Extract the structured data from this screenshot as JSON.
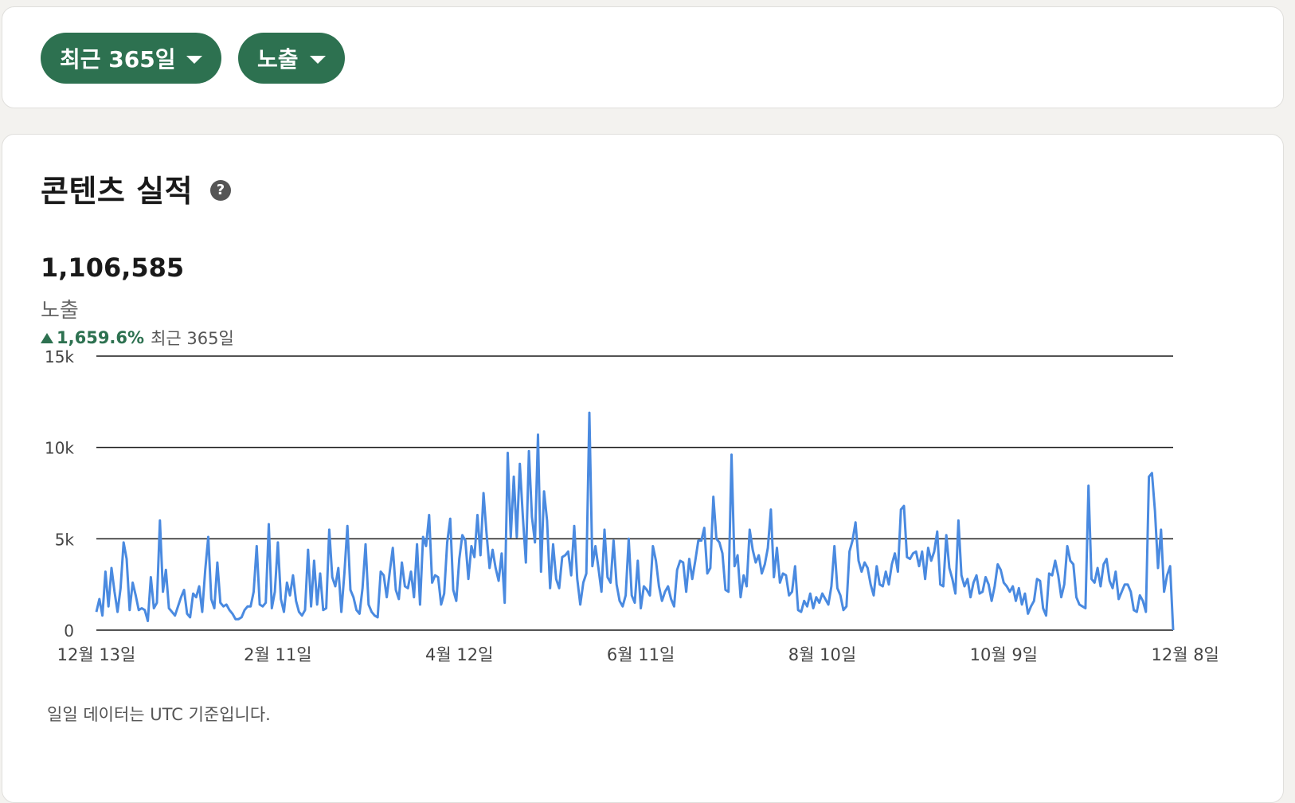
{
  "filters": {
    "range_label": "최근 365일",
    "metric_label": "노출"
  },
  "performance": {
    "title": "콘텐츠 실적",
    "help_icon": "question-circle-icon",
    "total_value": "1,106,585",
    "metric": "노출",
    "change_percent": "1,659.6%",
    "change_period": "최근 365일",
    "footnote": "일일 데이터는 UTC 기준입니다."
  },
  "colors": {
    "accent": "#2d7150",
    "line": "#4a8ae0",
    "grid": "#1a1a1a"
  },
  "chart_data": {
    "type": "line",
    "y_ticks": [
      "0",
      "5k",
      "10k",
      "15k"
    ],
    "ylim": [
      0,
      15000
    ],
    "x_tick_labels": [
      "12월 13일",
      "2월 11일",
      "4월 12일",
      "6월 11일",
      "8월 10일",
      "10월 9일",
      "12월 8일"
    ],
    "x_tick_days": [
      0,
      60,
      120,
      180,
      240,
      300,
      360
    ],
    "series": [
      {
        "values": [
          1000,
          1700,
          800,
          3200,
          1300,
          3400,
          2100,
          1000,
          2300,
          4800,
          3900,
          1100,
          2600,
          1900,
          1100,
          1200,
          1100,
          500,
          2900,
          1200,
          1500,
          6000,
          2100,
          3300,
          1200,
          1000,
          800,
          1300,
          1800,
          2200,
          900,
          700,
          2000,
          1800,
          2400,
          1000,
          3300,
          5100,
          1700,
          1200,
          3700,
          1500,
          1300,
          1400,
          1100,
          900,
          600,
          600,
          700,
          1100,
          1300,
          1300,
          2100,
          4600,
          1400,
          1300,
          1500,
          5800,
          1200,
          2100,
          4800,
          1700,
          1000,
          2600,
          1900,
          3000,
          1600,
          1000,
          800,
          1100,
          4400,
          1300,
          3800,
          1400,
          3100,
          1100,
          1200,
          5500,
          2900,
          2400,
          3400,
          1000,
          3100,
          5700,
          2200,
          1800,
          1100,
          900,
          2300,
          4700,
          1400,
          1000,
          800,
          700,
          3200,
          3000,
          1800,
          3200,
          4500,
          2200,
          1700,
          3700,
          2400,
          2300,
          3200,
          1800,
          4700,
          1400,
          5100,
          4600,
          6300,
          2600,
          3000,
          2900,
          1400,
          2000,
          4800,
          6100,
          2200,
          1600,
          3900,
          5200,
          4900,
          2800,
          4600,
          4000,
          6300,
          4100,
          7500,
          5300,
          3400,
          4400,
          3400,
          2700,
          4200,
          1500,
          9700,
          5100,
          8400,
          5100,
          9100,
          6200,
          3700,
          9800,
          6200,
          4800,
          10700,
          3200,
          7600,
          6000,
          2300,
          4700,
          2800,
          2300,
          4000,
          4100,
          4300,
          3000,
          5700,
          2800,
          1400,
          2600,
          3100,
          11900,
          3500,
          4600,
          3400,
          2100,
          5500,
          2900,
          2600,
          4900,
          2500,
          1600,
          1300,
          1900,
          5000,
          1900,
          1500,
          3800,
          1200,
          2400,
          2200,
          1900,
          4600,
          3800,
          2400,
          1600,
          2100,
          2400,
          1700,
          1300,
          3300,
          3800,
          3700,
          2100,
          3900,
          2800,
          3800,
          4900,
          4900,
          5600,
          3100,
          3400,
          7300,
          5000,
          4800,
          4200,
          2200,
          2100,
          9600,
          3500,
          4100,
          1800,
          3000,
          2400,
          5500,
          4400,
          3700,
          4100,
          3100,
          3600,
          4500,
          6600,
          2900,
          4500,
          2600,
          3100,
          3000,
          1900,
          2100,
          3500,
          1100,
          1000,
          1600,
          1300,
          2000,
          1200,
          1800,
          1500,
          2000,
          1700,
          1400,
          2400,
          4600,
          2300,
          1900,
          1100,
          1300,
          4300,
          4900,
          5900,
          3800,
          3200,
          3700,
          3400,
          2500,
          1900,
          3500,
          2500,
          2400,
          3200,
          2500,
          3600,
          4200,
          3200,
          6600,
          6800,
          4000,
          3900,
          4200,
          4300,
          3500,
          4300,
          2800,
          4500,
          3800,
          4300,
          5400,
          2500,
          2400,
          5200,
          3400,
          2800,
          2000,
          6000,
          3000,
          2400,
          2800,
          1800,
          2600,
          3000,
          2000,
          2100,
          2900,
          2500,
          1600,
          2400,
          3600,
          3300,
          2600,
          2400,
          2100,
          2400,
          1600,
          2300,
          1400,
          2000,
          900,
          1300,
          1600,
          2800,
          2700,
          1200,
          800,
          3100,
          3000,
          3800,
          3000,
          1800,
          2500,
          4600,
          3800,
          3600,
          1800,
          1400,
          1300,
          1200,
          7900,
          2800,
          2600,
          3400,
          2400,
          3600,
          3900,
          2700,
          2300,
          3200,
          1700,
          2100,
          2500,
          2500,
          2100,
          1100,
          1000,
          1900,
          1600,
          1000,
          8400,
          8600,
          6500,
          3400,
          5500,
          2100,
          3000,
          3500,
          0
        ]
      }
    ]
  }
}
